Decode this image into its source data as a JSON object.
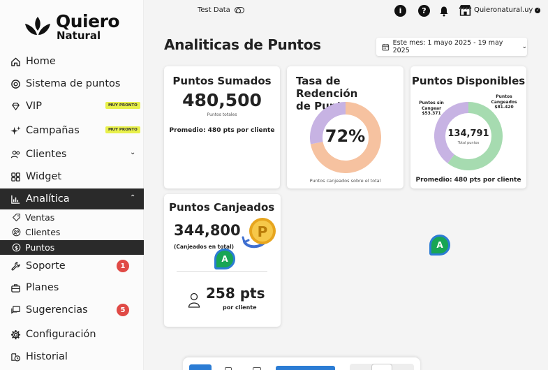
{
  "brand": {
    "line1": "Quiero",
    "line2": "Natural"
  },
  "topbar": {
    "test_data_label": "Test Data",
    "info_icon": "info-icon",
    "help_icon": "help-icon",
    "bell_icon": "bell-icon",
    "store_name": "Quieronatural.uy"
  },
  "sidebar": {
    "items": [
      {
        "label": "Home",
        "icon": "home-icon"
      },
      {
        "label": "Sistema de puntos",
        "icon": "points-icon"
      },
      {
        "label": "VIP",
        "icon": "diamond-icon",
        "badge": "MUY PRONTO"
      },
      {
        "label": "Campañas",
        "icon": "sparkle-icon",
        "badge": "MUY PRONTO"
      },
      {
        "label": "Clientes",
        "icon": "users-icon"
      },
      {
        "label": "Widget",
        "icon": "grid-icon"
      },
      {
        "label": "Analítica",
        "icon": "chart-icon"
      },
      {
        "label": "Soporte",
        "icon": "wrench-icon",
        "count": "1"
      },
      {
        "label": "Planes",
        "icon": "briefcase-icon"
      },
      {
        "label": "Sugerencias",
        "icon": "chat-icon",
        "count": "5"
      },
      {
        "label": "Configuración",
        "icon": "gear-icon"
      },
      {
        "label": "Historial",
        "icon": "history-icon"
      }
    ],
    "analytics_sub": [
      {
        "label": "Ventas",
        "icon": "tag-icon"
      },
      {
        "label": "Clientes",
        "icon": "users-circle-icon"
      },
      {
        "label": "Puntos",
        "icon": "dollar-circle-icon"
      }
    ]
  },
  "main": {
    "title": "Analiticas de Puntos",
    "date_range": "Este mes: 1 mayo 2025 - 19 may 2025",
    "cards": {
      "sumados": {
        "title": "Puntos Sumados",
        "value": "480,500",
        "caption": "Puntos totales",
        "promedio": "Promedio: 480 pts por cliente"
      },
      "redencion": {
        "title_line1": "Tasa de Redención",
        "title_line2": "de Puntos",
        "value": "72%",
        "caption": "Puntos canjeados sobre el total",
        "colors": {
          "redeemed": "#f6c2a0",
          "remaining": "#c7b3e3"
        }
      },
      "disponibles": {
        "title": "Puntos Disponibles",
        "center_value": "134,791",
        "center_caption": "Total puntos",
        "left_label_1": "Puntos sin",
        "left_label_2": "Cangear",
        "left_value": "$53.371",
        "right_label_1": "Puntos",
        "right_label_2": "Cangeados",
        "right_value": "$81.420",
        "promedio": "Promedio: 480 pts por cliente",
        "colors": {
          "canjeados": "#a6dbb0",
          "sin_canjear": "#c7b3e3"
        }
      },
      "canjeados": {
        "title": "Puntos Canjeados",
        "value": "344,800",
        "caption": "(Canjeados en total)",
        "per_client_value": "258 pts",
        "per_client_caption": "por cliente"
      }
    },
    "assistant_label": "A"
  },
  "chart_data": [
    {
      "type": "pie",
      "title": "Tasa de Redención de Puntos",
      "center_text": "72%",
      "labels": [
        "",
        ""
      ],
      "values": [
        72,
        28
      ]
    },
    {
      "type": "pie",
      "title": "Puntos Disponibles",
      "center_text": "134,791",
      "labels": [
        "Puntos Cangeados",
        "Puntos sin Cangear"
      ],
      "values": [
        81420,
        53371
      ]
    }
  ]
}
